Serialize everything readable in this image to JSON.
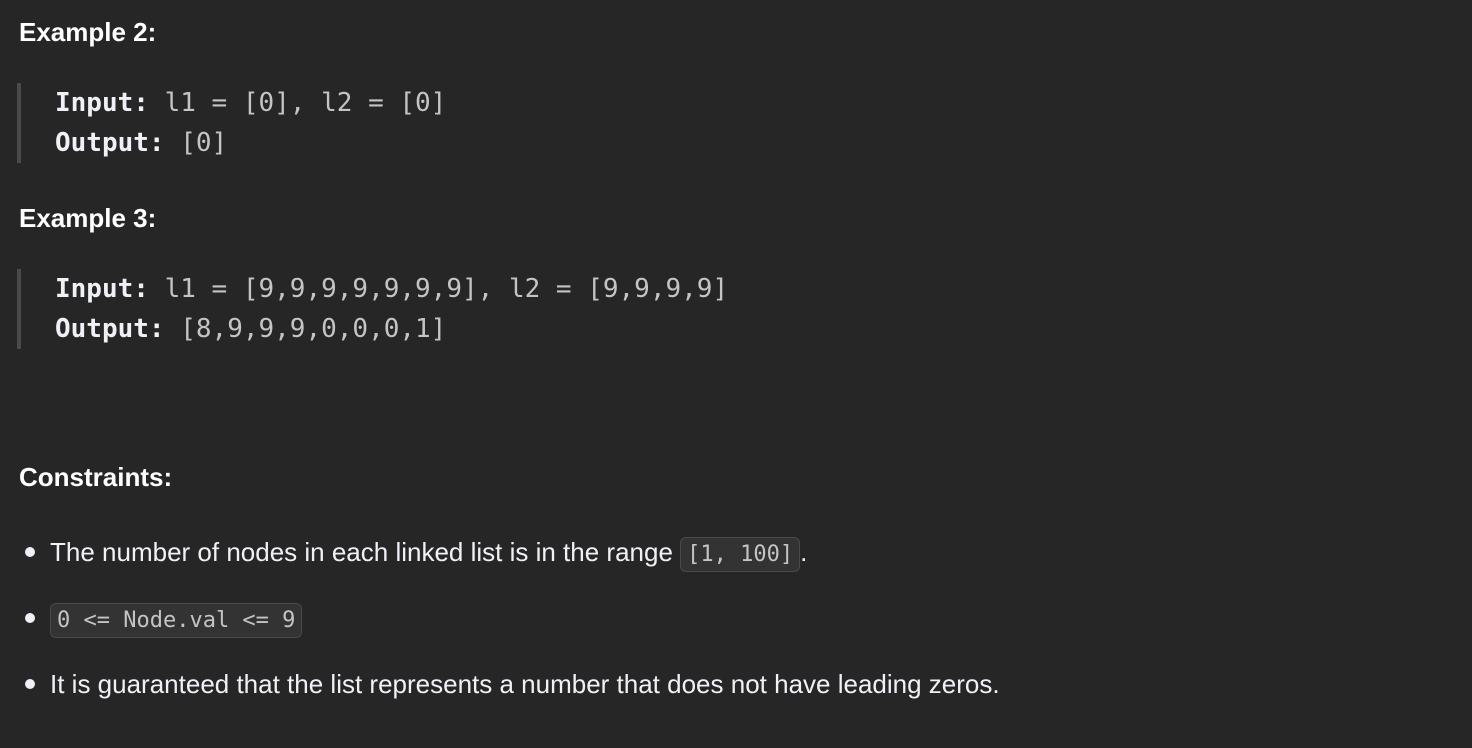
{
  "examples": [
    {
      "heading": "Example 2:",
      "input_label": "Input:",
      "input_value": " l1 = [0], l2 = [0]",
      "output_label": "Output:",
      "output_value": " [0]"
    },
    {
      "heading": "Example 3:",
      "input_label": "Input:",
      "input_value": " l1 = [9,9,9,9,9,9,9], l2 = [9,9,9,9]",
      "output_label": "Output:",
      "output_value": " [8,9,9,9,0,0,0,1]"
    }
  ],
  "constraints": {
    "heading": "Constraints:",
    "items": [
      {
        "text_before": "The number of nodes in each linked list is in the range ",
        "code": "[1, 100]",
        "text_after": "."
      },
      {
        "text_before": "",
        "code": "0 <= Node.val <= 9",
        "text_after": ""
      },
      {
        "text_before": "It is guaranteed that the list represents a number that does not have leading zeros.",
        "code": "",
        "text_after": ""
      }
    ]
  }
}
